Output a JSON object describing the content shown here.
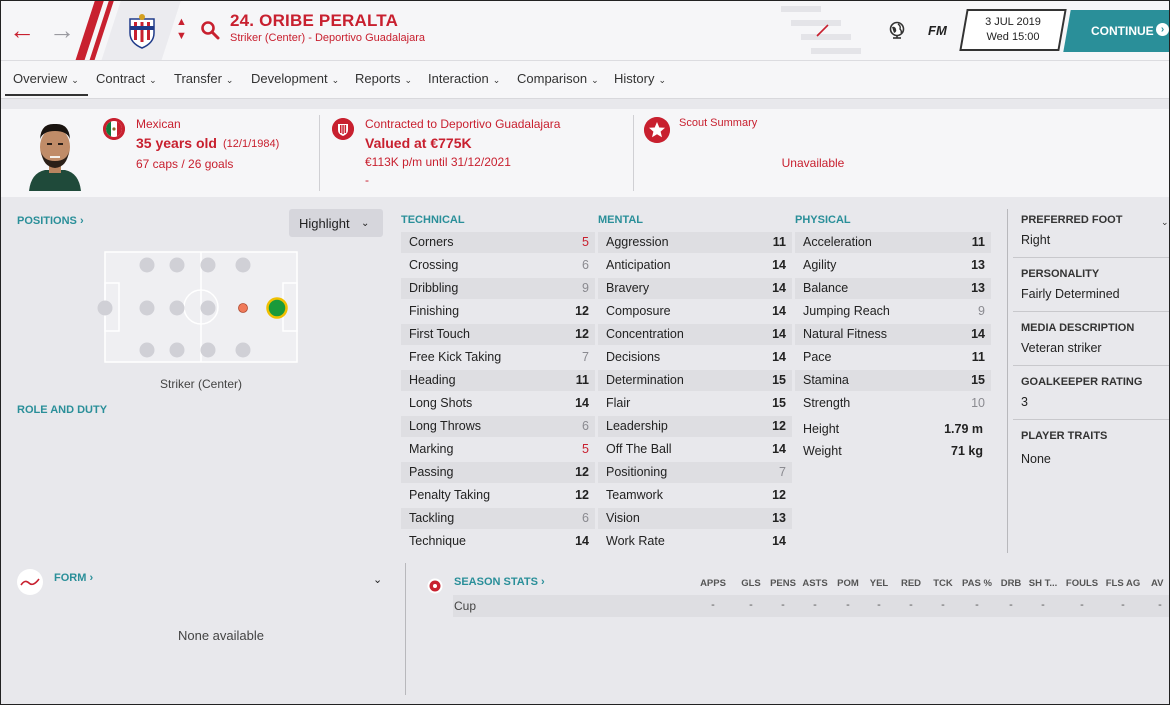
{
  "header": {
    "player_name": "24. ORIBE PERALTA",
    "player_sub": "Striker (Center) - Deportivo Guadalajara",
    "fm_logo": "FM",
    "date": "3 JUL 2019",
    "day_time": "Wed 15:00",
    "continue_label": "CONTINUE",
    "accent_color": "#c8202f",
    "teal_color": "#2a8f99"
  },
  "tabs": [
    {
      "label": "Overview"
    },
    {
      "label": "Contract"
    },
    {
      "label": "Transfer"
    },
    {
      "label": "Development"
    },
    {
      "label": "Reports"
    },
    {
      "label": "Interaction"
    },
    {
      "label": "Comparison"
    },
    {
      "label": "History"
    }
  ],
  "info": {
    "nationality": "Mexican",
    "age": "35 years old",
    "dob": "(12/1/1984)",
    "caps": "67 caps / 26 goals",
    "contracted": "Contracted to Deportivo Guadalajara",
    "value": "Valued at €775K",
    "wage": "€113K p/m until 31/12/2021",
    "dash": "-",
    "scout_title": "Scout Summary",
    "scout_status": "Unavailable"
  },
  "positions": {
    "title": "POSITIONS",
    "highlight": "Highlight",
    "label": "Striker (Center)",
    "role_title": "ROLE AND DUTY"
  },
  "technical": {
    "title": "TECHNICAL",
    "items": [
      {
        "name": "Corners",
        "value": "5",
        "tone": "low"
      },
      {
        "name": "Crossing",
        "value": "6",
        "tone": "dim"
      },
      {
        "name": "Dribbling",
        "value": "9",
        "tone": "dim"
      },
      {
        "name": "Finishing",
        "value": "12",
        "tone": "normal"
      },
      {
        "name": "First Touch",
        "value": "12",
        "tone": "normal"
      },
      {
        "name": "Free Kick Taking",
        "value": "7",
        "tone": "dim"
      },
      {
        "name": "Heading",
        "value": "11",
        "tone": "normal"
      },
      {
        "name": "Long Shots",
        "value": "14",
        "tone": "normal"
      },
      {
        "name": "Long Throws",
        "value": "6",
        "tone": "dim"
      },
      {
        "name": "Marking",
        "value": "5",
        "tone": "low"
      },
      {
        "name": "Passing",
        "value": "12",
        "tone": "normal"
      },
      {
        "name": "Penalty Taking",
        "value": "12",
        "tone": "normal"
      },
      {
        "name": "Tackling",
        "value": "6",
        "tone": "dim"
      },
      {
        "name": "Technique",
        "value": "14",
        "tone": "normal"
      }
    ]
  },
  "mental": {
    "title": "MENTAL",
    "items": [
      {
        "name": "Aggression",
        "value": "11",
        "tone": "normal"
      },
      {
        "name": "Anticipation",
        "value": "14",
        "tone": "normal"
      },
      {
        "name": "Bravery",
        "value": "14",
        "tone": "normal"
      },
      {
        "name": "Composure",
        "value": "14",
        "tone": "normal"
      },
      {
        "name": "Concentration",
        "value": "14",
        "tone": "normal"
      },
      {
        "name": "Decisions",
        "value": "14",
        "tone": "normal"
      },
      {
        "name": "Determination",
        "value": "15",
        "tone": "normal"
      },
      {
        "name": "Flair",
        "value": "15",
        "tone": "normal"
      },
      {
        "name": "Leadership",
        "value": "12",
        "tone": "normal"
      },
      {
        "name": "Off The Ball",
        "value": "14",
        "tone": "normal"
      },
      {
        "name": "Positioning",
        "value": "7",
        "tone": "dim"
      },
      {
        "name": "Teamwork",
        "value": "12",
        "tone": "normal"
      },
      {
        "name": "Vision",
        "value": "13",
        "tone": "normal"
      },
      {
        "name": "Work Rate",
        "value": "14",
        "tone": "normal"
      }
    ]
  },
  "physical": {
    "title": "PHYSICAL",
    "items": [
      {
        "name": "Acceleration",
        "value": "11",
        "tone": "normal"
      },
      {
        "name": "Agility",
        "value": "13",
        "tone": "normal"
      },
      {
        "name": "Balance",
        "value": "13",
        "tone": "normal"
      },
      {
        "name": "Jumping Reach",
        "value": "9",
        "tone": "dim"
      },
      {
        "name": "Natural Fitness",
        "value": "14",
        "tone": "normal"
      },
      {
        "name": "Pace",
        "value": "11",
        "tone": "normal"
      },
      {
        "name": "Stamina",
        "value": "15",
        "tone": "normal"
      },
      {
        "name": "Strength",
        "value": "10",
        "tone": "dim"
      }
    ],
    "height_label": "Height",
    "height_value": "1.79 m",
    "weight_label": "Weight",
    "weight_value": "71 kg"
  },
  "side": {
    "foot_title": "PREFERRED FOOT",
    "foot_value": "Right",
    "personality_title": "PERSONALITY",
    "personality_value": "Fairly Determined",
    "media_title": "MEDIA DESCRIPTION",
    "media_value": "Veteran striker",
    "gk_title": "GOALKEEPER RATING",
    "gk_value": "3",
    "traits_title": "PLAYER TRAITS",
    "traits_value": "None"
  },
  "form": {
    "title": "FORM",
    "empty": "None available"
  },
  "season_stats": {
    "title": "SEASON STATS",
    "headers": [
      "APPS",
      "GLS",
      "PENS",
      "ASTS",
      "POM",
      "YEL",
      "RED",
      "TCK",
      "PAS %",
      "DRB",
      "SH T...",
      "FOULS",
      "FLS AG",
      "AV"
    ],
    "row_label": "Cup",
    "row_values": [
      "-",
      "-",
      "-",
      "-",
      "-",
      "-",
      "-",
      "-",
      "-",
      "-",
      "-",
      "-",
      "-",
      "-"
    ]
  }
}
